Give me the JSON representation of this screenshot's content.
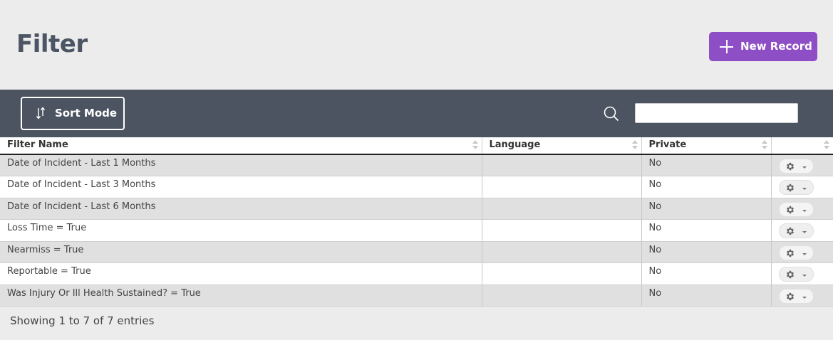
{
  "header": {
    "title": "Filter",
    "new_record_label": "New Record"
  },
  "toolbar": {
    "sort_mode_label": "Sort Mode",
    "search_value": ""
  },
  "table": {
    "columns": [
      "Filter Name",
      "Language",
      "Private",
      ""
    ],
    "rows": [
      {
        "name": "Date of Incident - Last 1 Months",
        "language": "",
        "private": "No"
      },
      {
        "name": "Date of Incident - Last 3 Months",
        "language": "",
        "private": "No"
      },
      {
        "name": "Date of Incident - Last 6 Months",
        "language": "",
        "private": "No"
      },
      {
        "name": "Loss Time = True",
        "language": "",
        "private": "No"
      },
      {
        "name": "Nearmiss = True",
        "language": "",
        "private": "No"
      },
      {
        "name": "Reportable = True",
        "language": "",
        "private": "No"
      },
      {
        "name": "Was Injury Or Ill Health Sustained? = True",
        "language": "",
        "private": "No"
      }
    ]
  },
  "footer": {
    "info": "Showing 1 to 7 of 7 entries"
  },
  "colors": {
    "brand_purple": "#8e4ec6",
    "toolbar_bg": "#4d5461",
    "title_color": "#4c5563"
  },
  "icons": {
    "new_record": "plus-icon",
    "sort_mode": "sort-arrows-icon",
    "search": "search-icon",
    "row_action": "gear-icon"
  }
}
